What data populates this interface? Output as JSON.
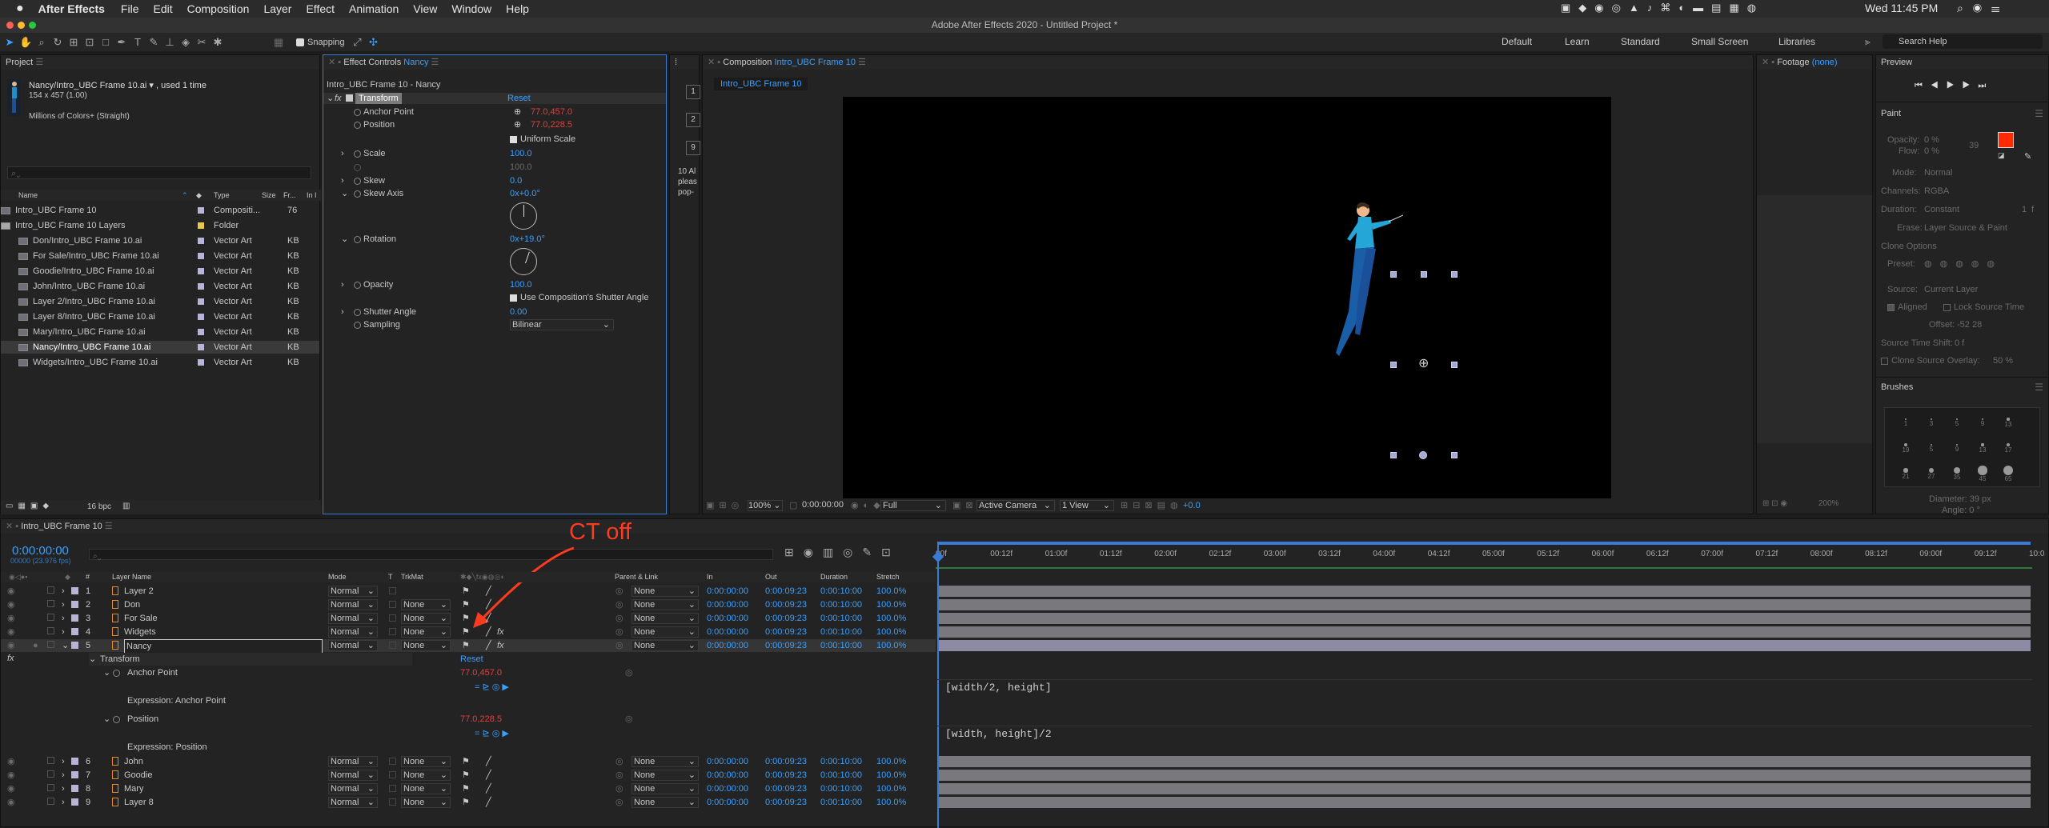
{
  "menubar": {
    "apple": "",
    "app": "After Effects",
    "items": [
      "File",
      "Edit",
      "Composition",
      "Layer",
      "Effect",
      "Animation",
      "View",
      "Window",
      "Help"
    ],
    "clock": "Wed 11:45 PM"
  },
  "window_title": "Adobe After Effects 2020 - Untitled Project *",
  "toolbar": {
    "snapping": "Snapping",
    "workspaces": [
      "Default",
      "Learn",
      "Standard",
      "Small Screen",
      "Libraries"
    ],
    "search_help": "Search Help"
  },
  "project": {
    "title": "Project",
    "selected_name": "Nancy/Intro_UBC Frame 10.ai ▾ , used 1 time",
    "dims": "154 x 457 (1.00)",
    "colors": "Millions of Colors+ (Straight)",
    "search_placeholder": "",
    "cols": {
      "name": "Name",
      "type": "Type",
      "size": "Size",
      "fr": "Fr...",
      "in": "In I"
    },
    "items": [
      {
        "name": "Intro_UBC Frame 10",
        "type": "Compositi...",
        "size": "76",
        "color": "#b8b4d8",
        "indent": 0
      },
      {
        "name": "Intro_UBC Frame 10 Layers",
        "type": "Folder",
        "size": "",
        "color": "#e6c94a",
        "indent": 0
      },
      {
        "name": "Don/Intro_UBC Frame 10.ai",
        "type": "Vector Art",
        "size": "KB",
        "color": "#b8b4d8",
        "indent": 1
      },
      {
        "name": "For Sale/Intro_UBC Frame 10.ai",
        "type": "Vector Art",
        "size": "KB",
        "color": "#b8b4d8",
        "indent": 1
      },
      {
        "name": "Goodie/Intro_UBC Frame 10.ai",
        "type": "Vector Art",
        "size": "KB",
        "color": "#b8b4d8",
        "indent": 1
      },
      {
        "name": "John/Intro_UBC Frame 10.ai",
        "type": "Vector Art",
        "size": "KB",
        "color": "#b8b4d8",
        "indent": 1
      },
      {
        "name": "Layer 2/Intro_UBC Frame 10.ai",
        "type": "Vector Art",
        "size": "KB",
        "color": "#b8b4d8",
        "indent": 1
      },
      {
        "name": "Layer 8/Intro_UBC Frame 10.ai",
        "type": "Vector Art",
        "size": "KB",
        "color": "#b8b4d8",
        "indent": 1
      },
      {
        "name": "Mary/Intro_UBC Frame 10.ai",
        "type": "Vector Art",
        "size": "KB",
        "color": "#b8b4d8",
        "indent": 1
      },
      {
        "name": "Nancy/Intro_UBC Frame 10.ai",
        "type": "Vector Art",
        "size": "KB",
        "color": "#b8b4d8",
        "indent": 1
      },
      {
        "name": "Widgets/Intro_UBC Frame 10.ai",
        "type": "Vector Art",
        "size": "KB",
        "color": "#b8b4d8",
        "indent": 1
      }
    ],
    "bpc": "16 bpc"
  },
  "effect_controls": {
    "title_prefix": "Effect Controls",
    "title_layer": "Nancy",
    "subtitle": "Intro_UBC Frame 10 - Nancy",
    "fx": "fx",
    "group": "Transform",
    "reset": "Reset",
    "props": {
      "anchor_label": "Anchor Point",
      "anchor_val": "77.0,457.0",
      "position_label": "Position",
      "position_val": "77.0,228.5",
      "uniform": "Uniform Scale",
      "scale_label": "Scale",
      "scale_val": "100.0",
      "scale_h": "100.0",
      "skew_label": "Skew",
      "skew_val": "0.0",
      "skewaxis_label": "Skew Axis",
      "skewaxis_val": "0x+0.0°",
      "rotation_label": "Rotation",
      "rotation_val": "0x+19.0°",
      "opacity_label": "Opacity",
      "opacity_val": "100.0",
      "shutter_check": "Use Composition's Shutter Angle",
      "shutter_label": "Shutter Angle",
      "shutter_val": "0.00",
      "sampling_label": "Sampling",
      "sampling_val": "Bilinear"
    }
  },
  "side_strip": {
    "n1": "1",
    "n2": "2",
    "n3": "9",
    "text1": "10 Al",
    "text2": "pleas",
    "text3": "pop-"
  },
  "composition": {
    "title_prefix": "Composition",
    "title_comp": "Intro_UBC Frame 10",
    "tab": "Intro_UBC Frame 10",
    "zoom": "100%",
    "timecode": "0:00:00:00",
    "resolution": "Full",
    "camera": "Active Camera",
    "view": "1 View",
    "exposure": "+0.0"
  },
  "footage": {
    "title_prefix": "Footage",
    "title_val": "(none)"
  },
  "preview": {
    "title": "Preview"
  },
  "paint": {
    "title": "Paint",
    "opacity": "Opacity:",
    "opacity_val": "0 %",
    "flow": "Flow:",
    "flow_val": "0 %",
    "mode": "Mode:",
    "mode_val": "Normal",
    "channels": "Channels:",
    "channels_val": "RGBA",
    "duration": "Duration:",
    "duration_val": "Constant",
    "erase": "Erase:",
    "erase_val": "Layer Source & Paint",
    "clone": "Clone Options",
    "preset": "Preset:",
    "source": "Source:",
    "source_val": "Current Layer",
    "aligned": "Aligned",
    "lock": "Lock Source Time",
    "offset": "Offset:",
    "offset_val": "-52   28",
    "shift": "Source Time Shift:",
    "shift_val": "0 f",
    "overlay": "Clone Source Overlay:",
    "overlay_val": "50 %",
    "fg_color": "#ff2a00",
    "mini1": "39",
    "mini2": "1",
    "mini3": "f"
  },
  "brushes": {
    "title": "Brushes",
    "sizes": [
      "1",
      "3",
      "5",
      "9",
      "13",
      "19",
      "5",
      "9",
      "13",
      "17",
      "21",
      "27",
      "35",
      "45",
      "65"
    ],
    "diameter": "Diameter:",
    "diameter_val": "39 px",
    "angle": "Angle:",
    "angle_val": "0 °",
    "zoom": "200%"
  },
  "timeline": {
    "comp_tab": "Intro_UBC Frame 10",
    "timecode": "0:00:00:00",
    "fps": "00000 (23.976 fps)",
    "annotation": "CT off",
    "annotation_color": "#ff3b1f",
    "cols": {
      "num": "#",
      "name": "Layer Name",
      "mode": "Mode",
      "t": "T",
      "trk": "TrkMat",
      "parent": "Parent & Link",
      "in": "In",
      "out": "Out",
      "dur": "Duration",
      "stretch": "Stretch"
    },
    "ruler": [
      "00f",
      "00:12f",
      "01:00f",
      "01:12f",
      "02:00f",
      "02:12f",
      "03:00f",
      "03:12f",
      "04:00f",
      "04:12f",
      "05:00f",
      "05:12f",
      "06:00f",
      "06:12f",
      "07:00f",
      "07:12f",
      "08:00f",
      "08:12f",
      "09:00f",
      "09:12f",
      "10:0"
    ],
    "layers_top": [
      {
        "num": "1",
        "name": "Layer 2",
        "mode": "Normal",
        "trk": "",
        "parent": "None",
        "in": "0:00:00:00",
        "out": "0:00:09:23",
        "dur": "0:00:10:00",
        "stretch": "100.0%"
      },
      {
        "num": "2",
        "name": "Don",
        "mode": "Normal",
        "trk": "None",
        "parent": "None",
        "in": "0:00:00:00",
        "out": "0:00:09:23",
        "dur": "0:00:10:00",
        "stretch": "100.0%"
      },
      {
        "num": "3",
        "name": "For Sale",
        "mode": "Normal",
        "trk": "None",
        "parent": "None",
        "in": "0:00:00:00",
        "out": "0:00:09:23",
        "dur": "0:00:10:00",
        "stretch": "100.0%"
      },
      {
        "num": "4",
        "name": "Widgets",
        "mode": "Normal",
        "trk": "None",
        "parent": "None",
        "in": "0:00:00:00",
        "out": "0:00:09:23",
        "dur": "0:00:10:00",
        "stretch": "100.0%"
      },
      {
        "num": "5",
        "name": "Nancy",
        "mode": "Normal",
        "trk": "None",
        "parent": "None",
        "in": "0:00:00:00",
        "out": "0:00:09:23",
        "dur": "0:00:10:00",
        "stretch": "100.0%"
      }
    ],
    "nancy_props": {
      "transform": "Transform",
      "reset": "Reset",
      "anchor": "Anchor Point",
      "anchor_val": "77.0,457.0",
      "expr_anchor": "Expression: Anchor Point",
      "code_anchor": "[width/2, height]",
      "position": "Position",
      "position_val": "77.0,228.5",
      "expr_position": "Expression: Position",
      "code_position": "[width, height]/2"
    },
    "layers_bottom": [
      {
        "num": "6",
        "name": "John",
        "mode": "Normal",
        "trk": "None",
        "parent": "None",
        "in": "0:00:00:00",
        "out": "0:00:09:23",
        "dur": "0:00:10:00",
        "stretch": "100.0%"
      },
      {
        "num": "7",
        "name": "Goodie",
        "mode": "Normal",
        "trk": "None",
        "parent": "None",
        "in": "0:00:00:00",
        "out": "0:00:09:23",
        "dur": "0:00:10:00",
        "stretch": "100.0%"
      },
      {
        "num": "8",
        "name": "Mary",
        "mode": "Normal",
        "trk": "None",
        "parent": "None",
        "in": "0:00:00:00",
        "out": "0:00:09:23",
        "dur": "0:00:10:00",
        "stretch": "100.0%"
      },
      {
        "num": "9",
        "name": "Layer 8",
        "mode": "Normal",
        "trk": "None",
        "parent": "None",
        "in": "0:00:00:00",
        "out": "0:00:09:23",
        "dur": "0:00:10:00",
        "stretch": "100.0%"
      }
    ]
  }
}
